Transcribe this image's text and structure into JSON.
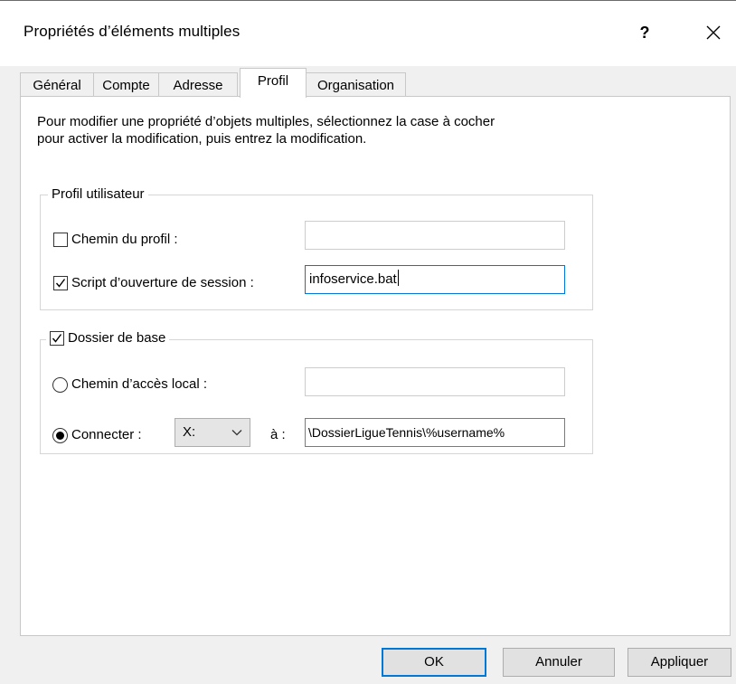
{
  "window": {
    "title": "Propriétés d’éléments multiples",
    "help_glyph": "?",
    "close_icon": "close-icon"
  },
  "tabs": [
    {
      "label": "Général",
      "active": false
    },
    {
      "label": "Compte",
      "active": false
    },
    {
      "label": "Adresse",
      "active": false
    },
    {
      "label": "Profil",
      "active": true
    },
    {
      "label": "Organisation",
      "active": false
    }
  ],
  "instructions": {
    "line1": "Pour modifier une propriété d’objets multiples, sélectionnez la case à cocher",
    "line2": "pour activer la modification, puis entrez la modification."
  },
  "profile_group": {
    "legend": "Profil utilisateur",
    "profile_path": {
      "checked": false,
      "label": "Chemin du profil :",
      "value": ""
    },
    "logon_script": {
      "checked": true,
      "label": "Script d’ouverture de session :",
      "value": "infoservice.bat"
    }
  },
  "home_group": {
    "legend": "Dossier de base",
    "checked": true,
    "local_path": {
      "selected": false,
      "label": "Chemin d’accès local :",
      "value": ""
    },
    "connect": {
      "selected": true,
      "label": "Connecter :",
      "drive": "X:",
      "to_label": "à :",
      "value": "\\DossierLigueTennis\\%username%"
    }
  },
  "buttons": {
    "ok": "OK",
    "cancel": "Annuler",
    "apply": "Appliquer"
  },
  "colors": {
    "accent": "#0078d7",
    "window_bg": "#f0f0f0",
    "panel_bg": "#ffffff"
  }
}
